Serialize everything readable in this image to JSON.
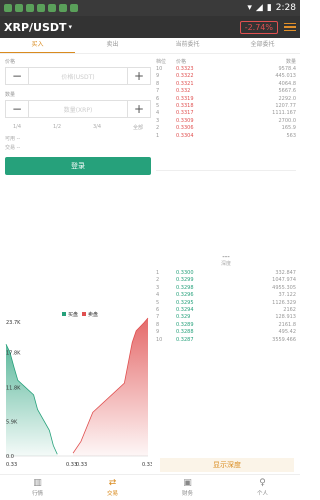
{
  "status": {
    "time": "2:28"
  },
  "header": {
    "pair": "XRP/USDT",
    "caret": "▾",
    "change": "-2.74%"
  },
  "tabs": [
    {
      "label": "买入",
      "active": true
    },
    {
      "label": "卖出",
      "active": false
    },
    {
      "label": "当前委托",
      "active": false
    },
    {
      "label": "全部委托",
      "active": false
    }
  ],
  "form": {
    "price_label": "价格",
    "price_placeholder": "价格(USDT)",
    "amount_label": "数量",
    "amount_placeholder": "数量(XRP)",
    "pcts": [
      "1/4",
      "1/2",
      "3/4",
      "全部"
    ],
    "avail_label": "可用 --",
    "trade_label": "交易 --",
    "login_label": "登录"
  },
  "book": {
    "headers": [
      "档位",
      "价格",
      "数量"
    ],
    "sells": [
      [
        "10",
        "0.3323",
        "9578.4"
      ],
      [
        "9",
        "0.3322",
        "445.013"
      ],
      [
        "8",
        "0.3321",
        "4064.8"
      ],
      [
        "7",
        "0.332",
        "5667.6"
      ],
      [
        "6",
        "0.3319",
        "2292.0"
      ],
      [
        "5",
        "0.3318",
        "1207.77"
      ],
      [
        "4",
        "0.3317",
        "1111.167"
      ],
      [
        "3",
        "0.3309",
        "2700.0"
      ],
      [
        "2",
        "0.3306",
        "165.9"
      ],
      [
        "1",
        "0.3304",
        "563"
      ]
    ],
    "divider": "---",
    "divider_text": "深度",
    "buys": [
      [
        "1",
        "0.3300",
        "332.847"
      ],
      [
        "2",
        "0.3299",
        "1047.974"
      ],
      [
        "3",
        "0.3298",
        "4955.305"
      ],
      [
        "4",
        "0.3296",
        "37.122"
      ],
      [
        "5",
        "0.3295",
        "1126.329"
      ],
      [
        "6",
        "0.3294",
        "2162"
      ],
      [
        "7",
        "0.329",
        "128.913"
      ],
      [
        "8",
        "0.3289",
        "2161.8"
      ],
      [
        "9",
        "0.3288",
        "495.42"
      ],
      [
        "10",
        "0.3287",
        "3559.466"
      ]
    ],
    "more_label": "显示深度"
  },
  "chart_data": {
    "type": "area",
    "legend": [
      "买盘",
      "卖盘"
    ],
    "y_ticks": [
      "23.7K",
      "17.8K",
      "11.8K",
      "5.9K",
      "0.0"
    ],
    "x_ticks": [
      "0.33",
      "0.33",
      "0.33",
      "0.33"
    ],
    "ylim": [
      0,
      23700
    ],
    "series": [
      {
        "name": "买盘",
        "color": "#26a17b",
        "x": [
          0.3287,
          0.3288,
          0.3289,
          0.329,
          0.3294,
          0.3295,
          0.3296,
          0.3298,
          0.3299,
          0.33
        ],
        "values": [
          19200,
          17800,
          15300,
          13000,
          10500,
          8000,
          6800,
          4400,
          1800,
          300
        ]
      },
      {
        "name": "卖盘",
        "color": "#e05050",
        "x": [
          0.3304,
          0.3306,
          0.3309,
          0.3317,
          0.3318,
          0.3319,
          0.332,
          0.3321,
          0.3322,
          0.3323
        ],
        "values": [
          500,
          2500,
          7500,
          12500,
          16000,
          19500,
          21500,
          22200,
          22900,
          23700
        ]
      }
    ]
  },
  "nav": [
    {
      "icon": "▥",
      "label": "行情",
      "active": false,
      "name": "market"
    },
    {
      "icon": "⇄",
      "label": "交易",
      "active": true,
      "name": "trade"
    },
    {
      "icon": "▣",
      "label": "财务",
      "active": false,
      "name": "finance"
    },
    {
      "icon": "♀",
      "label": "个人",
      "active": false,
      "name": "profile"
    }
  ]
}
